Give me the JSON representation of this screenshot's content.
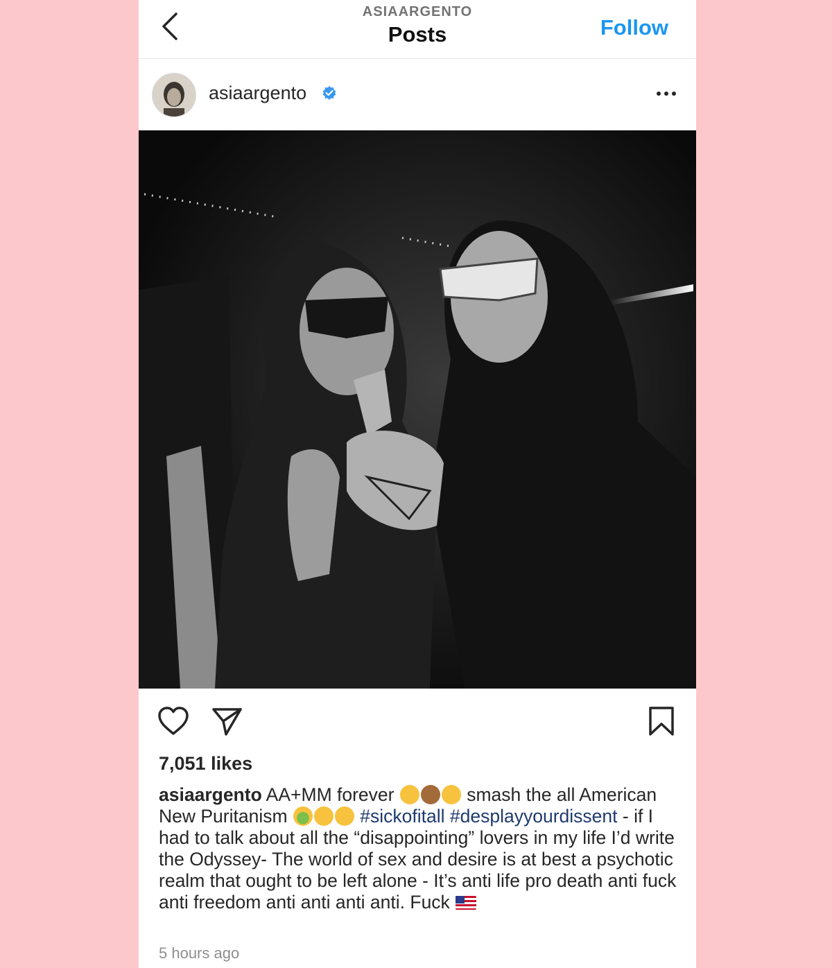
{
  "header": {
    "account_label": "ASIAARGENTO",
    "title": "Posts",
    "follow_label": "Follow",
    "back_icon": "chevron-left-icon"
  },
  "post": {
    "username": "asiaargento",
    "verified": true,
    "more_icon": "more-horizontal-icon",
    "photo_description_icon": "post-photo",
    "likes": "7,051 likes",
    "caption": {
      "username": "asiaargento",
      "part1": " AA+MM forever ",
      "emojis1": [
        "yawning-face",
        "see-no-evil-monkey",
        "shushing-face"
      ],
      "part2": " smash the all American New Puritanism ",
      "emojis2": [
        "nauseated-face",
        "exploding-head",
        "dizzy-face"
      ],
      "hashtag1": "#sickofitall",
      "hashtag2": "#desplayyourdissent",
      "part3": " - if I had to talk about all the “disappointing” lovers in my life I’d write the Odyssey- The world of sex and desire is at best a psychotic realm that ought to be left alone - It’s anti life pro death anti fuck anti freedom anti anti anti anti. Fuck ",
      "emoji_end": "us-flag"
    },
    "timestamp": "5 hours ago"
  },
  "colors": {
    "background": "#fdc8cb",
    "follow_blue": "#1c96f0",
    "hashtag": "#1e3a6e",
    "verified_blue": "#3897f0"
  },
  "icons": {
    "like": "heart-icon",
    "share": "paper-plane-icon",
    "save": "bookmark-icon"
  }
}
